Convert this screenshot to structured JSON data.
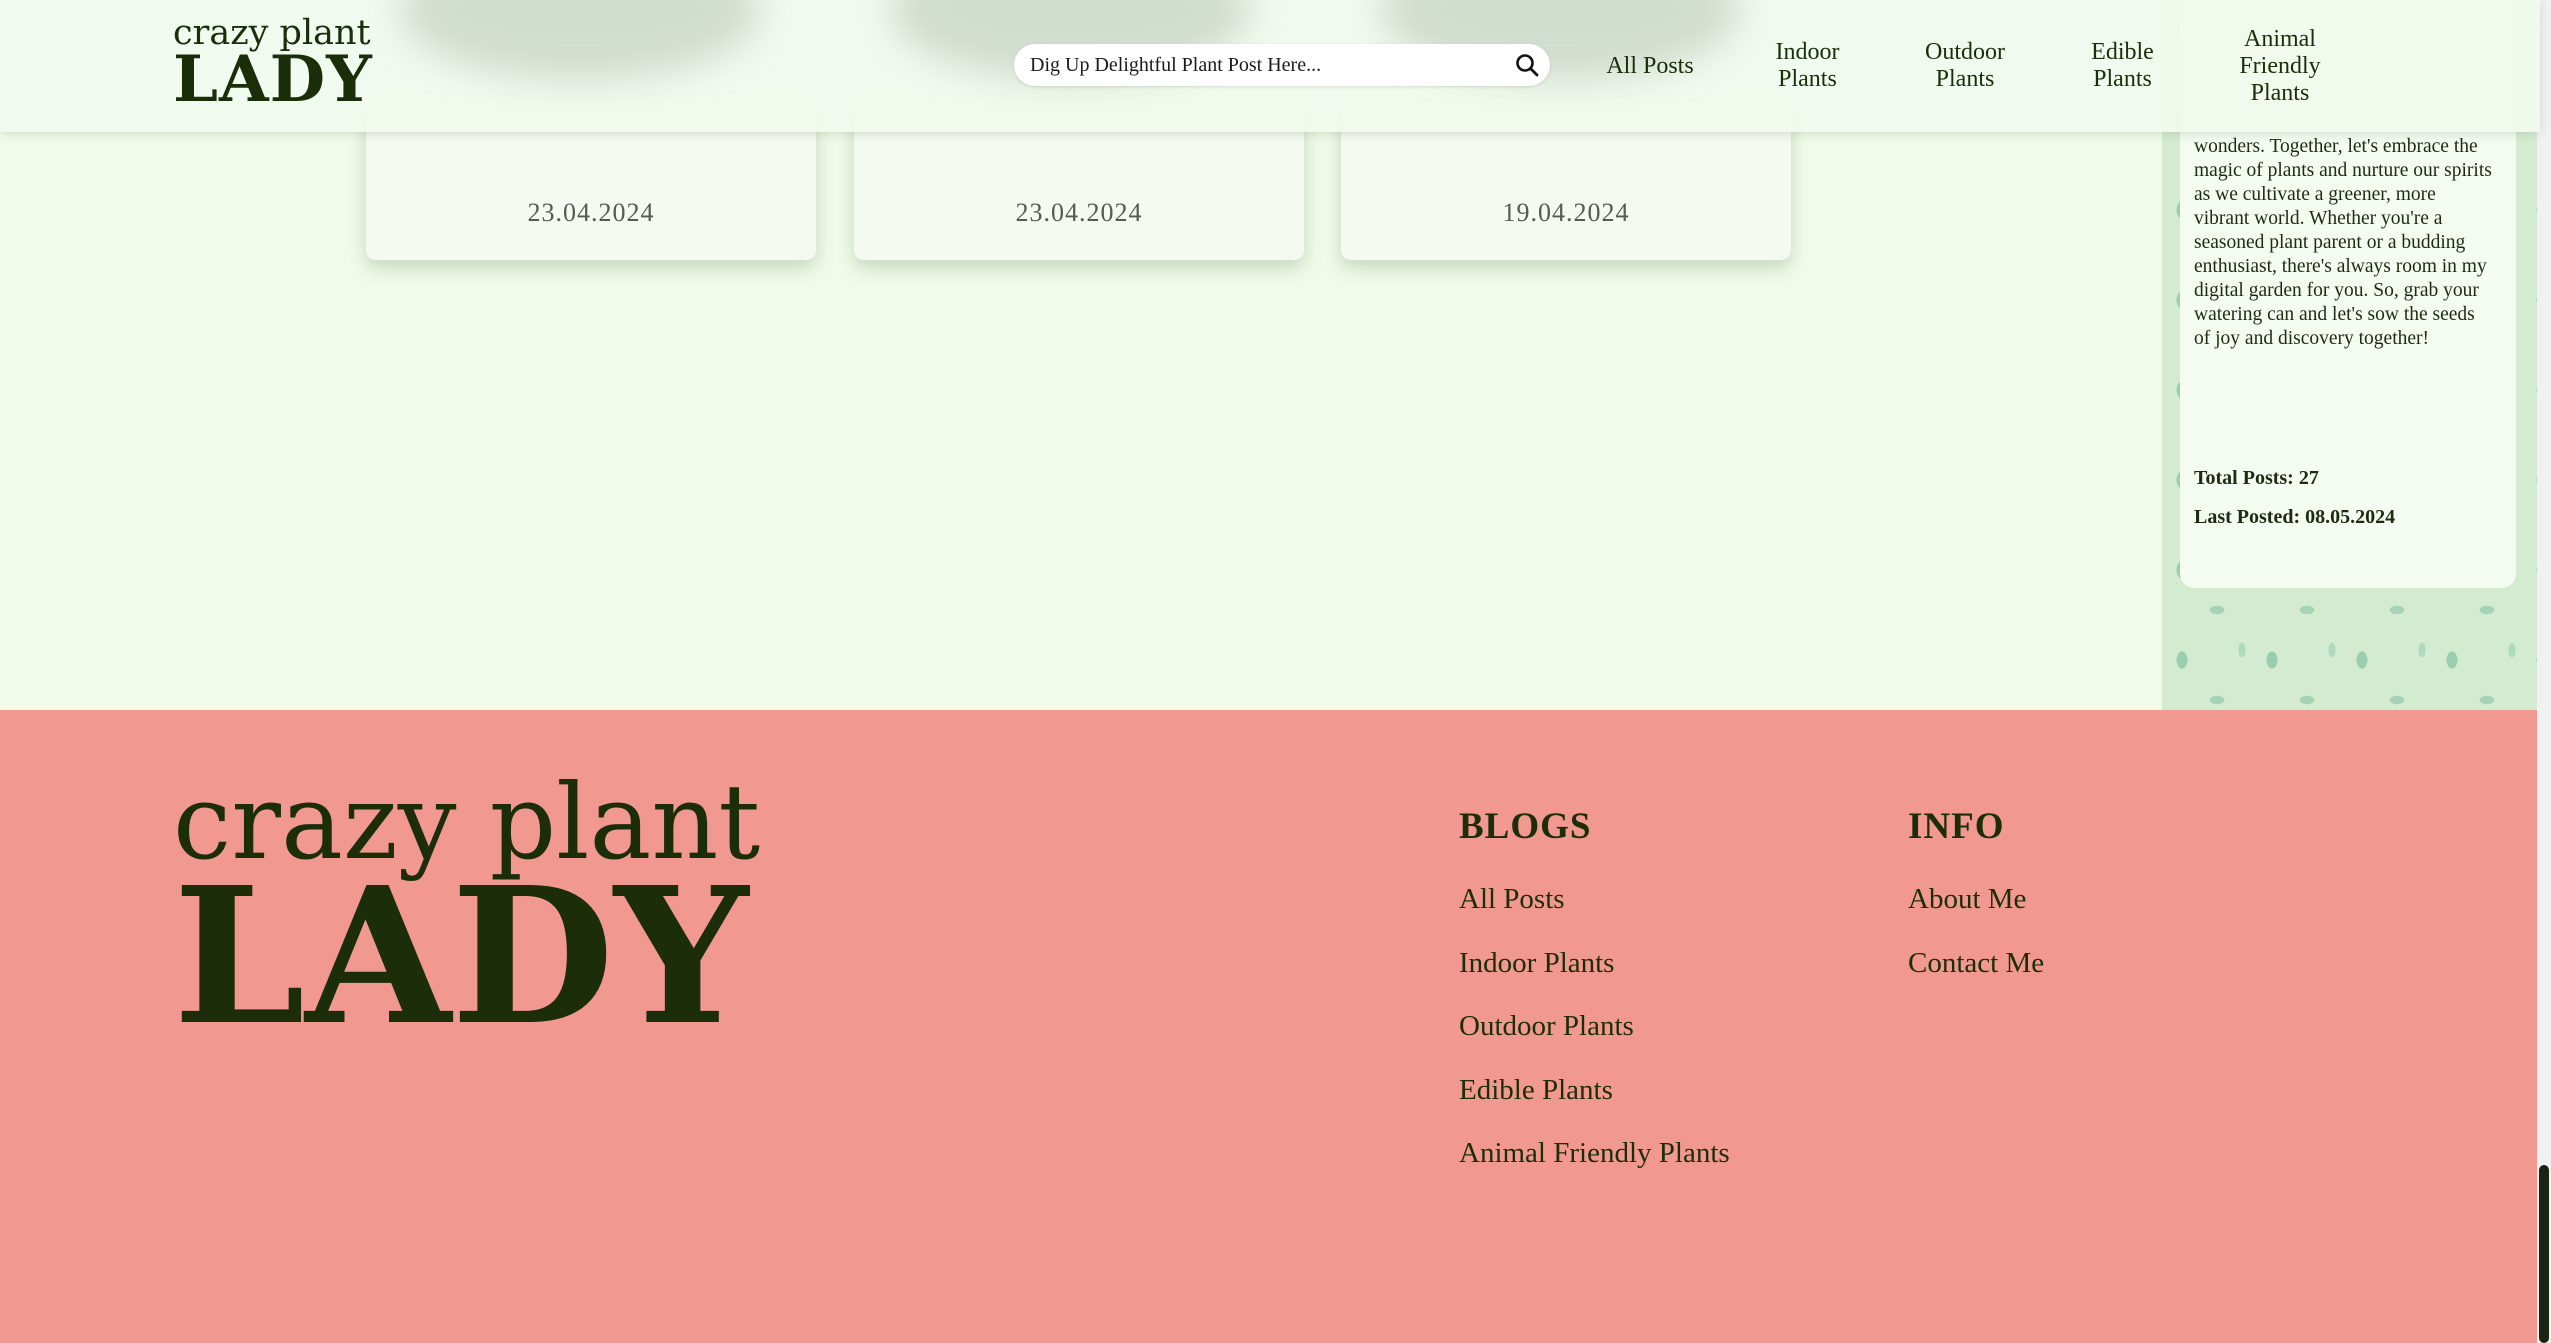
{
  "header": {
    "logo_top": "crazy plant",
    "logo_bottom": "LADY",
    "search_placeholder": "Dig Up Delightful Plant Post Here...",
    "nav": {
      "all_posts": "All Posts",
      "indoor_line1": "Indoor",
      "indoor_line2": "Plants",
      "outdoor_line1": "Outdoor",
      "outdoor_line2": "Plants",
      "edible_line1": "Edible",
      "edible_line2": "Plants",
      "animal_line1": "Animal",
      "animal_line2": "Friendly",
      "animal_line3": "Plants"
    }
  },
  "posts": [
    {
      "date": "23.04.2024"
    },
    {
      "date": "23.04.2024"
    },
    {
      "date": "19.04.2024"
    }
  ],
  "sidebar": {
    "bio": "wonders. Together, let's embrace the magic of plants and nurture our spirits as we cultivate a greener, more vibrant world. Whether you're a seasoned plant parent or a budding enthusiast, there's always room in my digital garden for you. So, grab your watering can and let's sow the seeds of joy and discovery together!",
    "total_posts": "Total Posts: 27",
    "last_posted": "Last Posted: 08.05.2024"
  },
  "footer": {
    "logo_top": "crazy plant",
    "logo_bottom": "LADY",
    "blogs_heading": "BLOGS",
    "blogs": [
      "All Posts",
      "Indoor Plants",
      "Outdoor Plants",
      "Edible Plants",
      "Animal Friendly Plants"
    ],
    "info_heading": "INFO",
    "info": [
      "About Me",
      "Contact Me"
    ]
  },
  "colors": {
    "page_bg": "#f0fce8",
    "footer_bg": "#f19891",
    "text_dark": "#1a2e0a"
  },
  "icons": {
    "search": "search-icon"
  }
}
